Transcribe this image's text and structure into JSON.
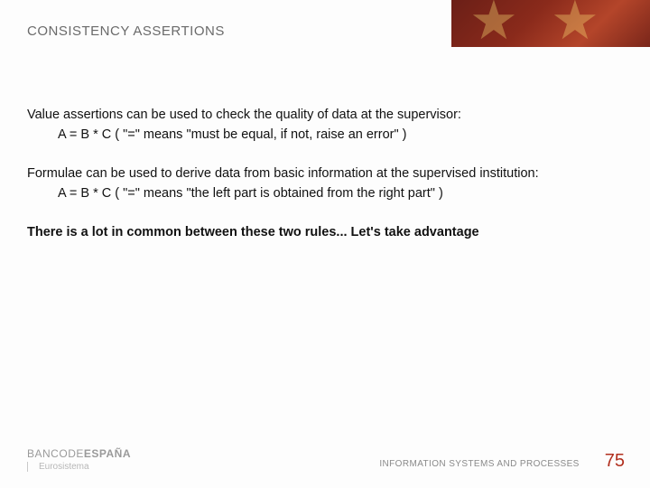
{
  "title": "CONSISTENCY ASSERTIONS",
  "para1_intro": "Value assertions can be used to check the quality of data at the supervisor:",
  "para1_formula": "A = B * C   ( \"=\" means \"must be equal, if not, raise an error\" )",
  "para2_intro": "Formulae can be used to derive data from basic information at the supervised institution:",
  "para2_formula": "A = B * C   ( \"=\" means \"the left part is obtained from the right part\" )",
  "para3": "There is a lot in common between these two rules... Let's take advantage",
  "logo_banco": "BANCO",
  "logo_de": "DE",
  "logo_espana": "ESPAÑA",
  "logo_sub": "Eurosistema",
  "department": "INFORMATION SYSTEMS AND PROCESSES",
  "page": "75"
}
